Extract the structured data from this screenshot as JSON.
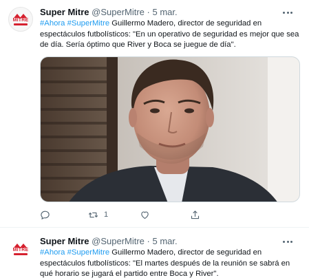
{
  "tweets": [
    {
      "avatar_text": "MITRE",
      "name": "Super Mitre",
      "handle": "@SuperMitre",
      "separator": "·",
      "date": "5 mar.",
      "hashtags": [
        "#Ahora",
        "#SuperMitre"
      ],
      "text": "Guillermo Madero, director de seguridad en espectáculos futbolísticos: \"En un operativo de seguridad es mejor que sea de día. Sería óptimo que River y Boca se juegue de día\".",
      "media_alt": "video frame",
      "actions": {
        "reply_icon": "reply-icon",
        "retweet_icon": "retweet-icon",
        "retweet_count": "1",
        "like_icon": "heart-icon",
        "share_icon": "share-icon"
      }
    },
    {
      "avatar_text": "MITRE",
      "name": "Super Mitre",
      "handle": "@SuperMitre",
      "separator": "·",
      "date": "5 mar.",
      "hashtags": [
        "#Ahora",
        "#SuperMitre"
      ],
      "text": "Guillermo Madero, director de seguridad en espectáculos futbolísticos: \"El martes después de la reunión se sabrá en qué horario se jugará el partido entre Boca y River\"."
    }
  ],
  "colors": {
    "link": "#1d9bf0",
    "secondary_text": "#536471",
    "brand_red": "#d6202e"
  }
}
